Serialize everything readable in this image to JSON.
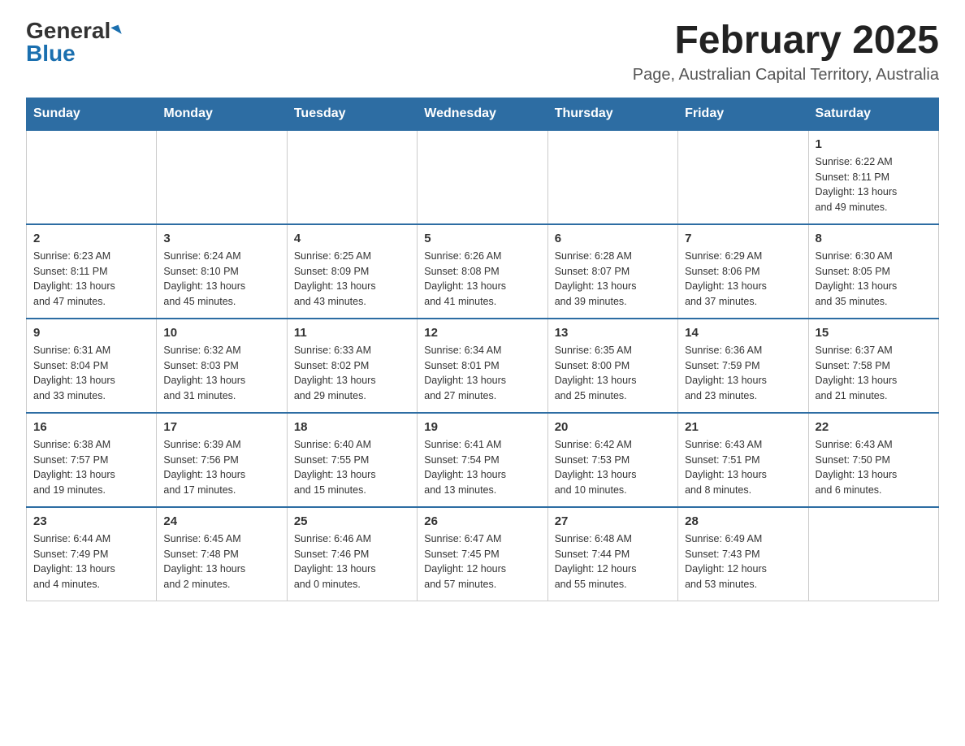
{
  "logo": {
    "general": "General",
    "blue": "Blue"
  },
  "title": "February 2025",
  "location": "Page, Australian Capital Territory, Australia",
  "days_of_week": [
    "Sunday",
    "Monday",
    "Tuesday",
    "Wednesday",
    "Thursday",
    "Friday",
    "Saturday"
  ],
  "weeks": [
    [
      {
        "day": "",
        "info": ""
      },
      {
        "day": "",
        "info": ""
      },
      {
        "day": "",
        "info": ""
      },
      {
        "day": "",
        "info": ""
      },
      {
        "day": "",
        "info": ""
      },
      {
        "day": "",
        "info": ""
      },
      {
        "day": "1",
        "info": "Sunrise: 6:22 AM\nSunset: 8:11 PM\nDaylight: 13 hours\nand 49 minutes."
      }
    ],
    [
      {
        "day": "2",
        "info": "Sunrise: 6:23 AM\nSunset: 8:11 PM\nDaylight: 13 hours\nand 47 minutes."
      },
      {
        "day": "3",
        "info": "Sunrise: 6:24 AM\nSunset: 8:10 PM\nDaylight: 13 hours\nand 45 minutes."
      },
      {
        "day": "4",
        "info": "Sunrise: 6:25 AM\nSunset: 8:09 PM\nDaylight: 13 hours\nand 43 minutes."
      },
      {
        "day": "5",
        "info": "Sunrise: 6:26 AM\nSunset: 8:08 PM\nDaylight: 13 hours\nand 41 minutes."
      },
      {
        "day": "6",
        "info": "Sunrise: 6:28 AM\nSunset: 8:07 PM\nDaylight: 13 hours\nand 39 minutes."
      },
      {
        "day": "7",
        "info": "Sunrise: 6:29 AM\nSunset: 8:06 PM\nDaylight: 13 hours\nand 37 minutes."
      },
      {
        "day": "8",
        "info": "Sunrise: 6:30 AM\nSunset: 8:05 PM\nDaylight: 13 hours\nand 35 minutes."
      }
    ],
    [
      {
        "day": "9",
        "info": "Sunrise: 6:31 AM\nSunset: 8:04 PM\nDaylight: 13 hours\nand 33 minutes."
      },
      {
        "day": "10",
        "info": "Sunrise: 6:32 AM\nSunset: 8:03 PM\nDaylight: 13 hours\nand 31 minutes."
      },
      {
        "day": "11",
        "info": "Sunrise: 6:33 AM\nSunset: 8:02 PM\nDaylight: 13 hours\nand 29 minutes."
      },
      {
        "day": "12",
        "info": "Sunrise: 6:34 AM\nSunset: 8:01 PM\nDaylight: 13 hours\nand 27 minutes."
      },
      {
        "day": "13",
        "info": "Sunrise: 6:35 AM\nSunset: 8:00 PM\nDaylight: 13 hours\nand 25 minutes."
      },
      {
        "day": "14",
        "info": "Sunrise: 6:36 AM\nSunset: 7:59 PM\nDaylight: 13 hours\nand 23 minutes."
      },
      {
        "day": "15",
        "info": "Sunrise: 6:37 AM\nSunset: 7:58 PM\nDaylight: 13 hours\nand 21 minutes."
      }
    ],
    [
      {
        "day": "16",
        "info": "Sunrise: 6:38 AM\nSunset: 7:57 PM\nDaylight: 13 hours\nand 19 minutes."
      },
      {
        "day": "17",
        "info": "Sunrise: 6:39 AM\nSunset: 7:56 PM\nDaylight: 13 hours\nand 17 minutes."
      },
      {
        "day": "18",
        "info": "Sunrise: 6:40 AM\nSunset: 7:55 PM\nDaylight: 13 hours\nand 15 minutes."
      },
      {
        "day": "19",
        "info": "Sunrise: 6:41 AM\nSunset: 7:54 PM\nDaylight: 13 hours\nand 13 minutes."
      },
      {
        "day": "20",
        "info": "Sunrise: 6:42 AM\nSunset: 7:53 PM\nDaylight: 13 hours\nand 10 minutes."
      },
      {
        "day": "21",
        "info": "Sunrise: 6:43 AM\nSunset: 7:51 PM\nDaylight: 13 hours\nand 8 minutes."
      },
      {
        "day": "22",
        "info": "Sunrise: 6:43 AM\nSunset: 7:50 PM\nDaylight: 13 hours\nand 6 minutes."
      }
    ],
    [
      {
        "day": "23",
        "info": "Sunrise: 6:44 AM\nSunset: 7:49 PM\nDaylight: 13 hours\nand 4 minutes."
      },
      {
        "day": "24",
        "info": "Sunrise: 6:45 AM\nSunset: 7:48 PM\nDaylight: 13 hours\nand 2 minutes."
      },
      {
        "day": "25",
        "info": "Sunrise: 6:46 AM\nSunset: 7:46 PM\nDaylight: 13 hours\nand 0 minutes."
      },
      {
        "day": "26",
        "info": "Sunrise: 6:47 AM\nSunset: 7:45 PM\nDaylight: 12 hours\nand 57 minutes."
      },
      {
        "day": "27",
        "info": "Sunrise: 6:48 AM\nSunset: 7:44 PM\nDaylight: 12 hours\nand 55 minutes."
      },
      {
        "day": "28",
        "info": "Sunrise: 6:49 AM\nSunset: 7:43 PM\nDaylight: 12 hours\nand 53 minutes."
      },
      {
        "day": "",
        "info": ""
      }
    ]
  ]
}
